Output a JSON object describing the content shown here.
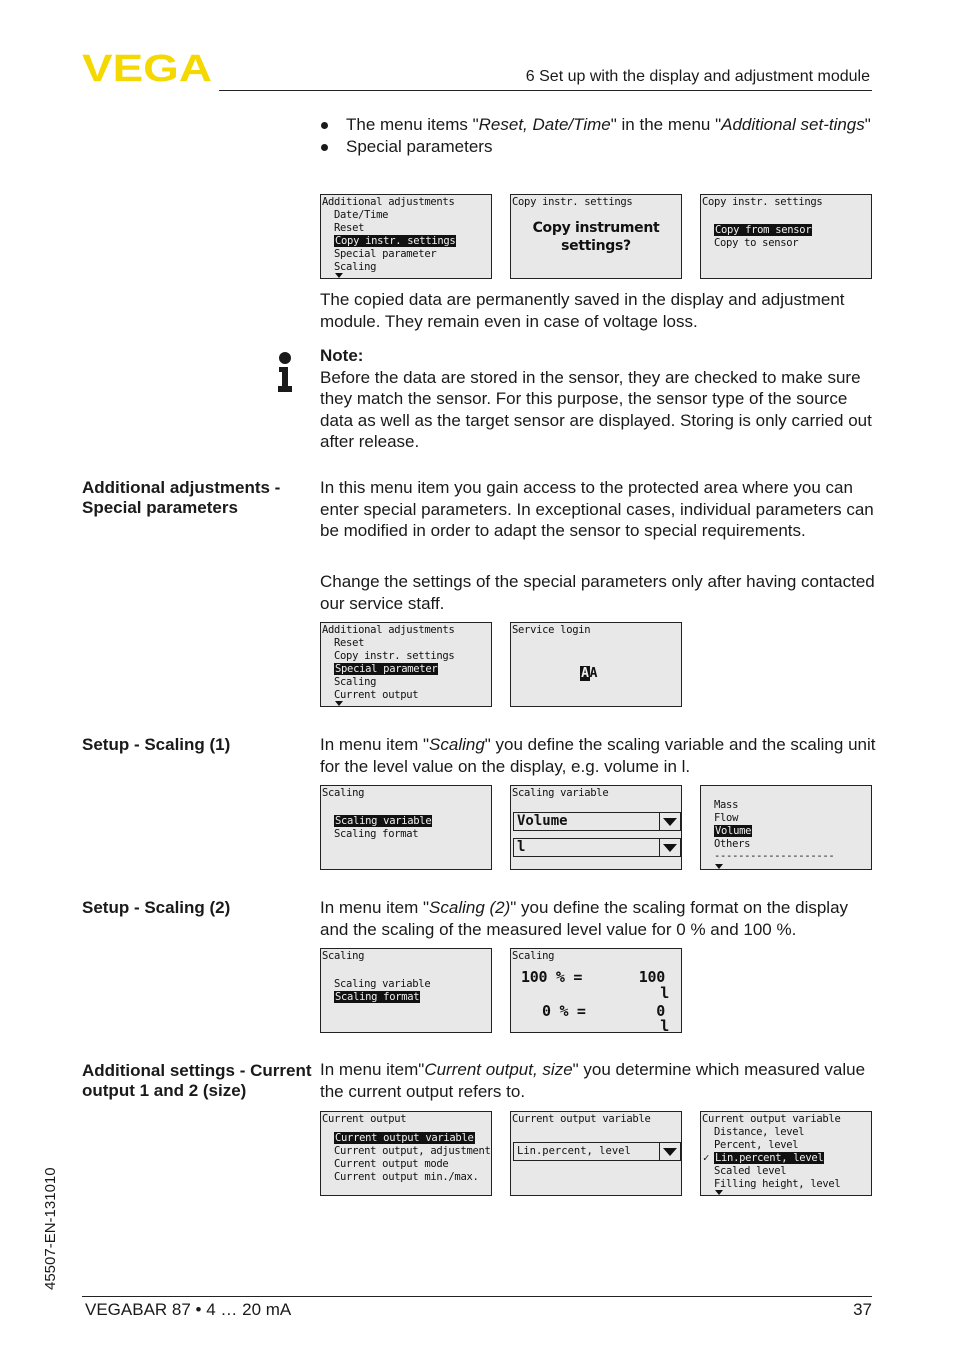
{
  "header": {
    "logo_text": "VEGA",
    "brand_color": "#f5d800",
    "section_title": "6 Set up with the display and adjustment module"
  },
  "intro_bullets": [
    {
      "prefix": "The menu items \"",
      "italic": "Reset, Date/Time",
      "middle": "\" in the menu \"",
      "italic2": "Additional set-tings",
      "suffix": "\""
    },
    {
      "text": "Special parameters"
    }
  ],
  "screens_copy": [
    {
      "title": "Additional adjustments",
      "items": [
        "Date/Time",
        "Reset",
        "Copy instr. settings",
        "Special parameter",
        "Scaling"
      ],
      "selected": "Copy instr. settings",
      "more_indicator": "arrow-down"
    },
    {
      "title": "Copy instr. settings",
      "prompt_line1": "Copy instrument",
      "prompt_line2": "settings?"
    },
    {
      "title": "Copy instr. settings",
      "items": [
        "Copy from sensor",
        "Copy to sensor"
      ],
      "selected": "Copy from sensor"
    }
  ],
  "copy_paragraph": "The copied data are permanently saved in the display and adjustment module. They remain even in case of voltage loss.",
  "note": {
    "icon": "info-icon",
    "title": "Note:",
    "text": "Before the data are stored in the sensor, they are checked to make sure they match the sensor. For this purpose, the sensor type of the source data as well as the target sensor are displayed. Storing is only carried out after release."
  },
  "sections": {
    "special_params": {
      "label": "Additional adjustments - Special parameters",
      "para1": "In this menu item you gain access to the protected area where you can enter special parameters. In exceptional cases, individual parameters can be modified in order to adapt the sensor to special requirements.",
      "para2": "Change the settings of the special parameters only after having contacted our service staff.",
      "screens": [
        {
          "title": "Additional adjustments",
          "items": [
            "Reset",
            "Copy instr. settings",
            "Special parameter",
            "Scaling",
            "Current output"
          ],
          "selected": "Special parameter",
          "more_indicator": "arrow-down"
        },
        {
          "title": "Service login",
          "input_cursor": "A",
          "input_value": "A"
        }
      ]
    },
    "scaling1": {
      "label": "Setup - Scaling (1)",
      "text_prefix": "In menu item \"",
      "text_italic": "Scaling",
      "text_suffix": "\" you define the scaling variable and the scaling unit for the level value on the display, e.g. volume in l.",
      "screens": [
        {
          "title": "Scaling",
          "items": [
            "Scaling variable",
            "Scaling format"
          ],
          "selected": "Scaling variable"
        },
        {
          "title": "Scaling variable",
          "dropdown1": "Volume",
          "dropdown2": "l"
        },
        {
          "title": "",
          "items": [
            "Mass",
            "Flow",
            "Volume",
            "Others"
          ],
          "selected": "Volume",
          "separator": "--------------------",
          "more_indicator": "arrow-down"
        }
      ]
    },
    "scaling2": {
      "label": "Setup - Scaling (2)",
      "text_prefix": "In menu item \"",
      "text_italic": "Scaling (2)",
      "text_suffix": "\" you define the scaling format on the display and the scaling of the measured level value for 0 % and 100 %.",
      "screens": [
        {
          "title": "Scaling",
          "items": [
            "Scaling variable",
            "Scaling format"
          ],
          "selected": "Scaling format"
        },
        {
          "title": "Scaling",
          "row1_label": "100 % =",
          "row1_value": "100",
          "row1_unit": "l",
          "row2_label": "0 % =",
          "row2_value": "0",
          "row2_unit": "l"
        }
      ]
    },
    "current_output": {
      "label": "Additional settings - Current output 1 and 2 (size)",
      "text_prefix": "In menu item\"",
      "text_italic": "Current output, size",
      "text_suffix": "\" you determine which measured value the current output refers to.",
      "screens": [
        {
          "title": "Current output",
          "items": [
            "Current output variable",
            "Current output, adjustment",
            "Current output mode",
            "Current output min./max."
          ],
          "selected": "Current output variable"
        },
        {
          "title": "Current output variable",
          "dropdown1": "Lin.percent, level"
        },
        {
          "title": "Current output variable",
          "items": [
            "Distance, level",
            "Percent, level",
            "Lin.percent, level",
            "Scaled level",
            "Filling height, level"
          ],
          "selected": "Lin.percent, level",
          "checked": "Lin.percent, level",
          "more_indicator": "arrow-down"
        }
      ]
    }
  },
  "footer": {
    "product": "VEGABAR 87 • 4 … 20 mA",
    "page_number": "37",
    "doc_id": "45507-EN-131010"
  }
}
